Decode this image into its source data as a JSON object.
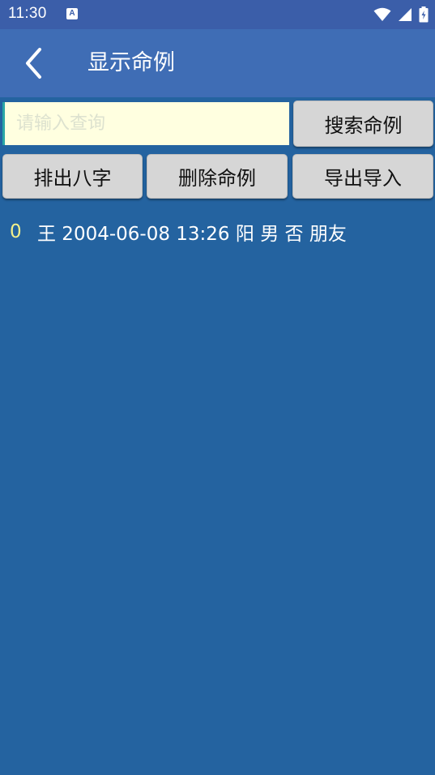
{
  "status_bar": {
    "time": "11:30",
    "notification_icon_letter": "A",
    "icons": [
      "wifi-icon",
      "cell-signal-icon",
      "battery-icon"
    ]
  },
  "header": {
    "back_icon": "chevron-left-icon",
    "title": "显示命例"
  },
  "search": {
    "value": "",
    "placeholder": "请输入查询",
    "button_label": "搜索命例"
  },
  "actions": {
    "bazi_label": "排出八字",
    "delete_label": "删除命例",
    "export_label": "导出导入"
  },
  "records": [
    {
      "index": "0",
      "text": "王 2004-06-08 13:26 阳 男 否 朋友"
    }
  ],
  "colors": {
    "background": "#2463a0",
    "status_bar": "#3b5ea9",
    "app_bar": "#3f6db5",
    "input_background": "#ffffe0",
    "button_background": "#d6d6d6",
    "index_text": "#f3f08a"
  }
}
